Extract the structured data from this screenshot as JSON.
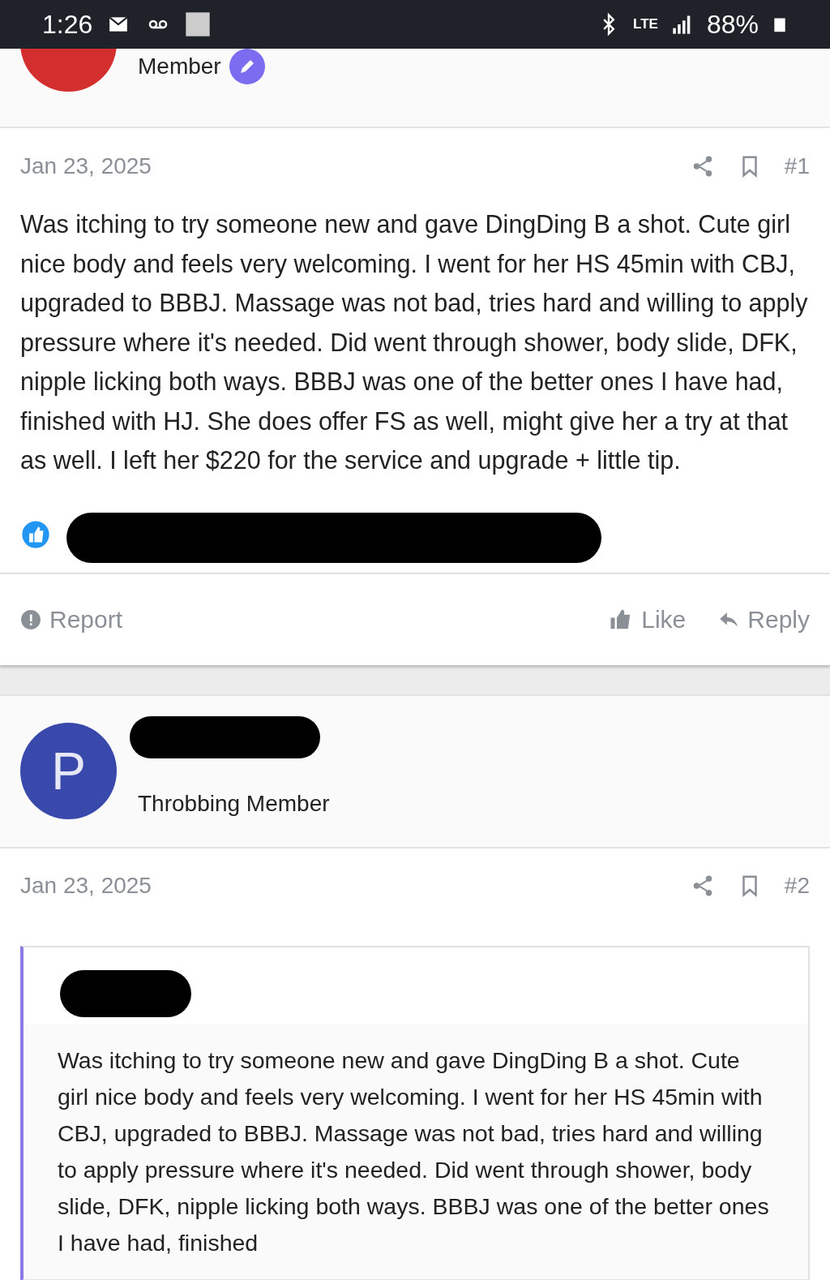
{
  "status_bar": {
    "time": "1:26",
    "network": "LTE",
    "battery": "88%"
  },
  "top_author": {
    "title": "Member"
  },
  "post": {
    "date": "Jan 23, 2025",
    "number": "#1",
    "body": "Was itching to try someone new and gave DingDing B a shot. Cute girl nice body and feels very welcoming. I went for her HS 45min with CBJ, upgraded to BBBJ. Massage was not bad, tries hard and willing to apply pressure where it's needed. Did went through shower, body slide, DFK, nipple licking both ways. BBBJ was one of the better ones I have had, finished with HJ. She does offer FS as well, might give her a try at that as well. I left her $220 for the service and upgrade + little tip.",
    "actions": {
      "report": "Report",
      "like": "Like",
      "reply": "Reply"
    }
  },
  "second_post": {
    "avatar_letter": "P",
    "title": "Throbbing Member",
    "date": "Jan 23, 2025",
    "number": "#2",
    "quote": {
      "text": "Was itching to try someone new and gave DingDing B a shot. Cute girl nice body and feels very welcoming. I went for her HS 45min with CBJ, upgraded to BBBJ. Massage was not bad, tries hard and willing to apply pressure where it's needed. Did went through shower, body slide, DFK, nipple licking both ways. BBBJ was one of the better ones I have had, finished"
    }
  }
}
